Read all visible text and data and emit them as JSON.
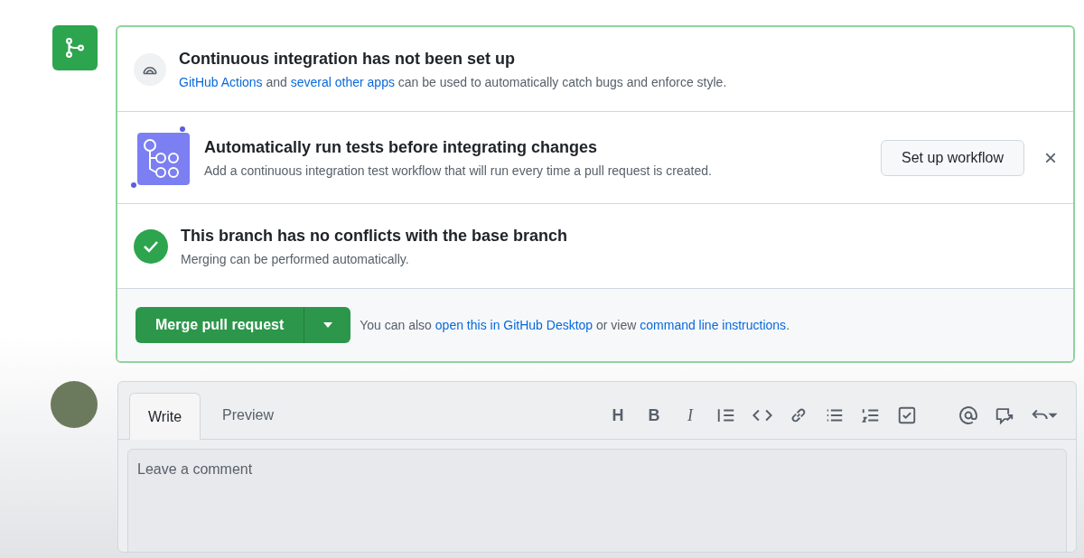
{
  "checks": [
    {
      "kind": "ci",
      "title": "Continuous integration has not been set up",
      "parts": [
        {
          "text": "GitHub Actions",
          "link": true
        },
        {
          "text": " and ",
          "link": false
        },
        {
          "text": "several other apps",
          "link": true
        },
        {
          "text": " can be used to automatically catch bugs and enforce style.",
          "link": false
        }
      ]
    },
    {
      "kind": "workflow",
      "title": "Automatically run tests before integrating changes",
      "parts": [
        {
          "text": "Add a continuous integration test workflow that will run every time a pull request is created.",
          "link": false
        }
      ],
      "button": "Set up workflow",
      "close": "×"
    },
    {
      "kind": "success",
      "title": "This branch has no conflicts with the base branch",
      "parts": [
        {
          "text": "Merging can be performed automatically.",
          "link": false
        }
      ]
    }
  ],
  "merge": {
    "button": "Merge pull request",
    "parts": [
      {
        "text": "You can also ",
        "link": false
      },
      {
        "text": "open this in GitHub Desktop",
        "link": true
      },
      {
        "text": " or view ",
        "link": false
      },
      {
        "text": "command line instructions",
        "link": true
      },
      {
        "text": ".",
        "link": false
      }
    ]
  },
  "comment": {
    "tabs": [
      {
        "label": "Write",
        "selected": true
      },
      {
        "label": "Preview",
        "selected": false
      }
    ],
    "toolbar": [
      {
        "kind": "glyph",
        "label": "H"
      },
      {
        "kind": "glyph",
        "label": "B"
      },
      {
        "kind": "glyph",
        "label": "I",
        "italic": true
      },
      {
        "kind": "quote"
      },
      {
        "kind": "code"
      },
      {
        "kind": "link"
      },
      {
        "kind": "bullets"
      },
      {
        "kind": "numbers"
      },
      {
        "kind": "tasks"
      },
      {
        "kind": "gap"
      },
      {
        "kind": "mention"
      },
      {
        "kind": "reference"
      },
      {
        "kind": "reply"
      }
    ],
    "placeholder": "Leave a comment"
  }
}
